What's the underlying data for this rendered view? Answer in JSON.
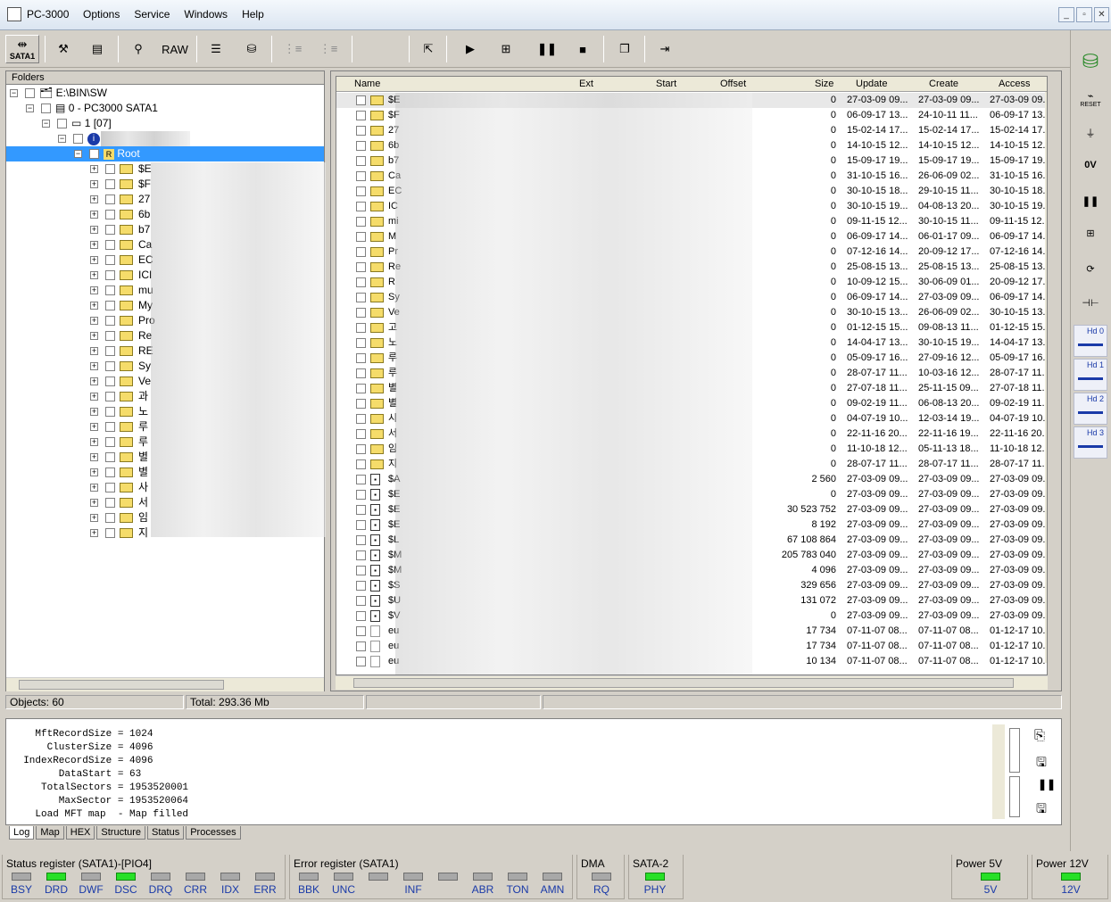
{
  "app": {
    "title": "PC-3000",
    "menu": [
      "Options",
      "Service",
      "Windows",
      "Help"
    ],
    "win_btns": [
      "_",
      "▫",
      "✕"
    ]
  },
  "toolbar": {
    "sata_label": "SATA1",
    "raw_label": "RAW"
  },
  "folders": {
    "header": "Folders",
    "root_path": "E:\\BIN\\SW",
    "device": "0 - PC3000 SATA1",
    "partition": "1 [07]",
    "root_label": "Root",
    "items": [
      "$E",
      "$F",
      "27",
      "6b",
      "b7",
      "Ca",
      "EC",
      "ICI",
      "mu",
      "My",
      "Pro",
      "Re",
      "RE",
      "Sy",
      "Ve",
      "과",
      "노",
      "루",
      "루",
      "별",
      "별",
      "사",
      "서",
      "임",
      "지"
    ]
  },
  "files": {
    "columns": {
      "name": "Name",
      "ext": "Ext",
      "start": "Start",
      "offset": "Offset",
      "size": "Size",
      "update": "Update",
      "create": "Create",
      "access": "Access"
    },
    "rows": [
      {
        "n": "$E",
        "size": "0",
        "upd": "27-03-09 09...",
        "cre": "27-03-09 09...",
        "acc": "27-03-09 09..",
        "t": "d"
      },
      {
        "n": "$F",
        "size": "0",
        "upd": "06-09-17 13...",
        "cre": "24-10-11 11...",
        "acc": "06-09-17 13.",
        "t": "d"
      },
      {
        "n": "27",
        "size": "0",
        "upd": "15-02-14 17...",
        "cre": "15-02-14 17...",
        "acc": "15-02-14 17.",
        "t": "d"
      },
      {
        "n": "6b",
        "size": "0",
        "upd": "14-10-15 12...",
        "cre": "14-10-15 12...",
        "acc": "14-10-15 12.",
        "t": "d"
      },
      {
        "n": "b7",
        "size": "0",
        "upd": "15-09-17 19...",
        "cre": "15-09-17 19...",
        "acc": "15-09-17 19.",
        "t": "d"
      },
      {
        "n": "Ca",
        "size": "0",
        "upd": "31-10-15 16...",
        "cre": "26-06-09 02...",
        "acc": "31-10-15 16.",
        "t": "d"
      },
      {
        "n": "EC",
        "size": "0",
        "upd": "30-10-15 18...",
        "cre": "29-10-15 11...",
        "acc": "30-10-15 18.",
        "t": "d"
      },
      {
        "n": "IC",
        "size": "0",
        "upd": "30-10-15 19...",
        "cre": "04-08-13 20...",
        "acc": "30-10-15 19.",
        "t": "d"
      },
      {
        "n": "mi",
        "size": "0",
        "upd": "09-11-15 12...",
        "cre": "30-10-15 11...",
        "acc": "09-11-15 12.",
        "t": "d"
      },
      {
        "n": "M",
        "size": "0",
        "upd": "06-09-17 14...",
        "cre": "06-01-17 09...",
        "acc": "06-09-17 14.",
        "t": "d"
      },
      {
        "n": "Pr",
        "size": "0",
        "upd": "07-12-16 14...",
        "cre": "20-09-12 17...",
        "acc": "07-12-16 14.",
        "t": "d"
      },
      {
        "n": "Re",
        "size": "0",
        "upd": "25-08-15 13...",
        "cre": "25-08-15 13...",
        "acc": "25-08-15 13.",
        "t": "d"
      },
      {
        "n": "R",
        "size": "0",
        "upd": "10-09-12 15...",
        "cre": "30-06-09 01...",
        "acc": "20-09-12 17.",
        "t": "d"
      },
      {
        "n": "Sy",
        "size": "0",
        "upd": "06-09-17 14...",
        "cre": "27-03-09 09...",
        "acc": "06-09-17 14.",
        "t": "d"
      },
      {
        "n": "Ve",
        "size": "0",
        "upd": "30-10-15 13...",
        "cre": "26-06-09 02...",
        "acc": "30-10-15 13.",
        "t": "d"
      },
      {
        "n": "고",
        "size": "0",
        "upd": "01-12-15 15...",
        "cre": "09-08-13 11...",
        "acc": "01-12-15 15.",
        "t": "d"
      },
      {
        "n": "노",
        "size": "0",
        "upd": "14-04-17 13...",
        "cre": "30-10-15 19...",
        "acc": "14-04-17 13.",
        "t": "d"
      },
      {
        "n": "루",
        "size": "0",
        "upd": "05-09-17 16...",
        "cre": "27-09-16 12...",
        "acc": "05-09-17 16.",
        "t": "d"
      },
      {
        "n": "루",
        "size": "0",
        "upd": "28-07-17 11...",
        "cre": "10-03-16 12...",
        "acc": "28-07-17 11.",
        "t": "d"
      },
      {
        "n": "별",
        "size": "0",
        "upd": "27-07-18 11...",
        "cre": "25-11-15 09...",
        "acc": "27-07-18 11.",
        "t": "d"
      },
      {
        "n": "별",
        "size": "0",
        "upd": "09-02-19 11...",
        "cre": "06-08-13 20...",
        "acc": "09-02-19 11.",
        "t": "d"
      },
      {
        "n": "시",
        "size": "0",
        "upd": "04-07-19 10...",
        "cre": "12-03-14 19...",
        "acc": "04-07-19 10.",
        "t": "d"
      },
      {
        "n": "서",
        "size": "0",
        "upd": "22-11-16 20...",
        "cre": "22-11-16 19...",
        "acc": "22-11-16 20.",
        "t": "d"
      },
      {
        "n": "임",
        "size": "0",
        "upd": "11-10-18 12...",
        "cre": "05-11-13 18...",
        "acc": "11-10-18 12.",
        "t": "d"
      },
      {
        "n": "지",
        "size": "0",
        "upd": "28-07-17 11...",
        "cre": "28-07-17 11...",
        "acc": "28-07-17 11.",
        "t": "d"
      },
      {
        "n": "$A",
        "size": "2 560",
        "upd": "27-03-09 09...",
        "cre": "27-03-09 09...",
        "acc": "27-03-09 09.",
        "t": "f"
      },
      {
        "n": "$E",
        "size": "0",
        "upd": "27-03-09 09...",
        "cre": "27-03-09 09...",
        "acc": "27-03-09 09.",
        "t": "f"
      },
      {
        "n": "$E",
        "size": "30 523 752",
        "upd": "27-03-09 09...",
        "cre": "27-03-09 09...",
        "acc": "27-03-09 09.",
        "t": "f"
      },
      {
        "n": "$E",
        "size": "8 192",
        "upd": "27-03-09 09...",
        "cre": "27-03-09 09...",
        "acc": "27-03-09 09.",
        "t": "f"
      },
      {
        "n": "$L",
        "size": "67 108 864",
        "upd": "27-03-09 09...",
        "cre": "27-03-09 09...",
        "acc": "27-03-09 09.",
        "t": "f"
      },
      {
        "n": "$M",
        "size": "205 783 040",
        "upd": "27-03-09 09...",
        "cre": "27-03-09 09...",
        "acc": "27-03-09 09.",
        "t": "f"
      },
      {
        "n": "$M",
        "size": "4 096",
        "upd": "27-03-09 09...",
        "cre": "27-03-09 09...",
        "acc": "27-03-09 09.",
        "t": "f"
      },
      {
        "n": "$S",
        "size": "329 656",
        "upd": "27-03-09 09...",
        "cre": "27-03-09 09...",
        "acc": "27-03-09 09.",
        "t": "f"
      },
      {
        "n": "$U",
        "size": "131 072",
        "upd": "27-03-09 09...",
        "cre": "27-03-09 09...",
        "acc": "27-03-09 09.",
        "t": "f"
      },
      {
        "n": "$V",
        "size": "0",
        "upd": "27-03-09 09...",
        "cre": "27-03-09 09...",
        "acc": "27-03-09 09.",
        "t": "f"
      },
      {
        "n": "eu",
        "size": "17 734",
        "upd": "07-11-07 08...",
        "cre": "07-11-07 08...",
        "acc": "01-12-17 10.",
        "t": "p"
      },
      {
        "n": "eu",
        "size": "17 734",
        "upd": "07-11-07 08...",
        "cre": "07-11-07 08...",
        "acc": "01-12-17 10.",
        "t": "p"
      },
      {
        "n": "eu",
        "size": "10 134",
        "upd": "07-11-07 08...",
        "cre": "07-11-07 08...",
        "acc": "01-12-17 10.",
        "t": "p"
      }
    ]
  },
  "status": {
    "objects": "Objects: 60",
    "total": "Total: 293.36 Mb"
  },
  "log": {
    "text": "    MftRecordSize = 1024\n      ClusterSize = 4096\n  IndexRecordSize = 4096\n        DataStart = 63\n     TotalSectors = 1953520001\n        MaxSector = 1953520064\n    Load MFT map  - Map filled"
  },
  "tabs": [
    "Log",
    "Map",
    "HEX",
    "Structure",
    "Status",
    "Processes"
  ],
  "right_panel": {
    "reset_label": "RESET",
    "hd_labels": [
      "Hd 0",
      "Hd 1",
      "Hd 2",
      "Hd 3"
    ]
  },
  "registers": {
    "status_title": "Status register (SATA1)-[PIO4]",
    "status_leds": [
      {
        "t": "BSY",
        "on": false
      },
      {
        "t": "DRD",
        "on": true
      },
      {
        "t": "DWF",
        "on": false
      },
      {
        "t": "DSC",
        "on": true
      },
      {
        "t": "DRQ",
        "on": false
      },
      {
        "t": "CRR",
        "on": false
      },
      {
        "t": "IDX",
        "on": false
      },
      {
        "t": "ERR",
        "on": false
      }
    ],
    "error_title": "Error register (SATA1)",
    "error_leds": [
      {
        "t": "BBK",
        "on": false
      },
      {
        "t": "UNC",
        "on": false
      },
      {
        "t": "",
        "on": false
      },
      {
        "t": "INF",
        "on": false
      },
      {
        "t": "",
        "on": false
      },
      {
        "t": "ABR",
        "on": false
      },
      {
        "t": "TON",
        "on": false
      },
      {
        "t": "AMN",
        "on": false
      }
    ],
    "dma_title": "DMA",
    "dma_led": "RQ",
    "sata_title": "SATA-2",
    "sata_led": "PHY",
    "p5_title": "Power 5V",
    "p5_led": "5V",
    "p12_title": "Power 12V",
    "p12_led": "12V"
  },
  "colors": {
    "led_on": "#27e027",
    "led_off": "#a8a8a8",
    "selection": "#3399ff",
    "blue_text": "#1a3aa8"
  }
}
